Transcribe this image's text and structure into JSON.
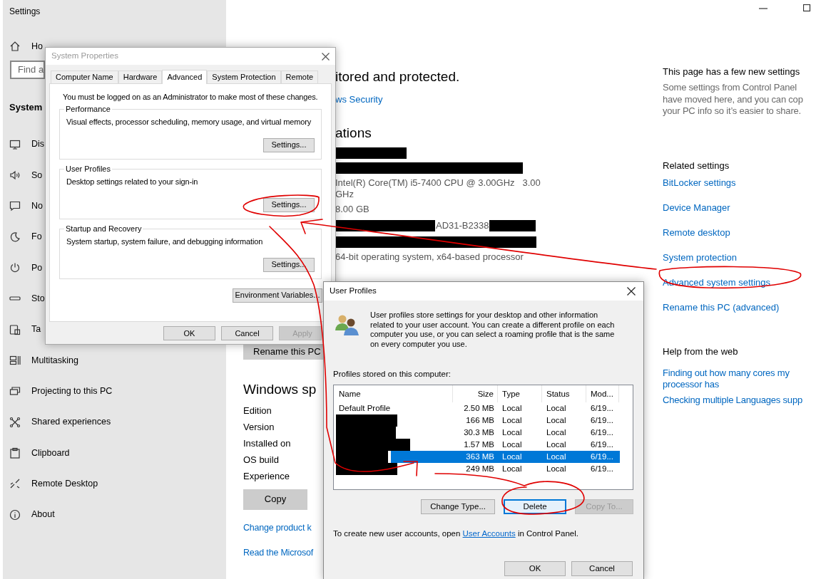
{
  "settings_window": {
    "title": "Settings",
    "sidebar": {
      "home": "Ho",
      "search_placeholder": "Find a",
      "section": "System",
      "items": [
        {
          "label": "Dis"
        },
        {
          "label": "So"
        },
        {
          "label": "No"
        },
        {
          "label": "Fo"
        },
        {
          "label": "Po"
        },
        {
          "label": "Sto"
        },
        {
          "label": "Ta"
        },
        {
          "label": "Multitasking"
        },
        {
          "label": "Projecting to this PC"
        },
        {
          "label": "Shared experiences"
        },
        {
          "label": "Clipboard"
        },
        {
          "label": "Remote Desktop"
        },
        {
          "label": "About"
        }
      ]
    },
    "main": {
      "security_status": "itored and protected.",
      "security_link": "ws Security",
      "specs_heading": "ations",
      "specs": [
        {
          "kind": "redacted"
        },
        {
          "kind": "redacted"
        },
        {
          "kind": "text",
          "value": "Intel(R) Core(TM) i5-7400 CPU @ 3.00GHz   3.00 GHz"
        },
        {
          "kind": "text",
          "value": "8.00 GB"
        },
        {
          "kind": "partly_redacted",
          "value": "AD31-B2338"
        },
        {
          "kind": "redacted"
        },
        {
          "kind": "text",
          "value": "64-bit operating system, x64-based processor"
        }
      ],
      "rename_button": "Rename this PC",
      "windows_heading": "Windows sp",
      "windows_fields": [
        "Edition",
        "Version",
        "Installed on",
        "OS build",
        "Experience"
      ],
      "copy_button": "Copy",
      "links": [
        "Change product k",
        "Read the Microsof"
      ]
    },
    "side": {
      "heading": "This page has a few new settings",
      "note_lines": [
        "Some settings from Control Panel",
        "have moved here, and you can cop",
        "your PC info so it’s easier to share."
      ],
      "related_heading": "Related settings",
      "related_links": [
        "BitLocker settings",
        "Device Manager",
        "Remote desktop",
        "System protection",
        "Advanced system settings",
        "Rename this PC (advanced)"
      ],
      "help_heading": "Help from the web",
      "help_links": [
        "Finding out how many cores my processor has",
        "Checking multiple Languages supp"
      ]
    }
  },
  "system_properties": {
    "title": "System Properties",
    "tabs": [
      {
        "label": "Computer Name",
        "selected": false
      },
      {
        "label": "Hardware",
        "selected": false
      },
      {
        "label": "Advanced",
        "selected": true
      },
      {
        "label": "System Protection",
        "selected": false
      },
      {
        "label": "Remote",
        "selected": false
      }
    ],
    "notice": "You must be logged on as an Administrator to make most of these changes.",
    "groups": [
      {
        "title": "Performance",
        "description": "Visual effects, processor scheduling, memory usage, and virtual memory",
        "button": "Settings..."
      },
      {
        "title": "User Profiles",
        "description": "Desktop settings related to your sign-in",
        "button": "Settings..."
      },
      {
        "title": "Startup and Recovery",
        "description": "System startup, system failure, and debugging information",
        "button": "Settings..."
      }
    ],
    "environment_button": "Environment Variables...",
    "buttons": [
      {
        "label": "OK",
        "disabled": false
      },
      {
        "label": "Cancel",
        "disabled": false
      },
      {
        "label": "Apply",
        "disabled": true
      }
    ]
  },
  "user_profiles": {
    "title": "User Profiles",
    "description": "User profiles store settings for your desktop and other information related to your user account. You can create a different profile on each computer you use, or you can select a roaming profile that is the same on every computer you use.",
    "list_label": "Profiles stored on this computer:",
    "columns": [
      "Name",
      "Size",
      "Type",
      "Status",
      "Mod..."
    ],
    "rows": [
      {
        "name": "Default Profile",
        "redacted": false,
        "size": "2.50 MB",
        "type": "Local",
        "status": "Local",
        "modified": "6/19...",
        "selected": false
      },
      {
        "redacted": true,
        "size": "166 MB",
        "type": "Local",
        "status": "Local",
        "modified": "6/19...",
        "selected": false
      },
      {
        "redacted": true,
        "size": "30.3 MB",
        "type": "Local",
        "status": "Local",
        "modified": "6/19...",
        "selected": false
      },
      {
        "redacted": true,
        "size": "1.57 MB",
        "type": "Local",
        "status": "Local",
        "modified": "6/19...",
        "selected": false
      },
      {
        "redacted": true,
        "size": "363 MB",
        "type": "Local",
        "status": "Local",
        "modified": "6/19...",
        "selected": true
      },
      {
        "redacted": true,
        "size": "249 MB",
        "type": "Local",
        "status": "Local",
        "modified": "6/19...",
        "selected": false
      }
    ],
    "actions": [
      {
        "label": "Change Type...",
        "disabled": false,
        "focused": false
      },
      {
        "label": "Delete",
        "disabled": false,
        "focused": true
      },
      {
        "label": "Copy To...",
        "disabled": true,
        "focused": false
      }
    ],
    "footer_before": "To create new user accounts, open",
    "footer_link": "User Accounts",
    "footer_after": "in Control Panel.",
    "buttons": [
      "OK",
      "Cancel"
    ]
  }
}
